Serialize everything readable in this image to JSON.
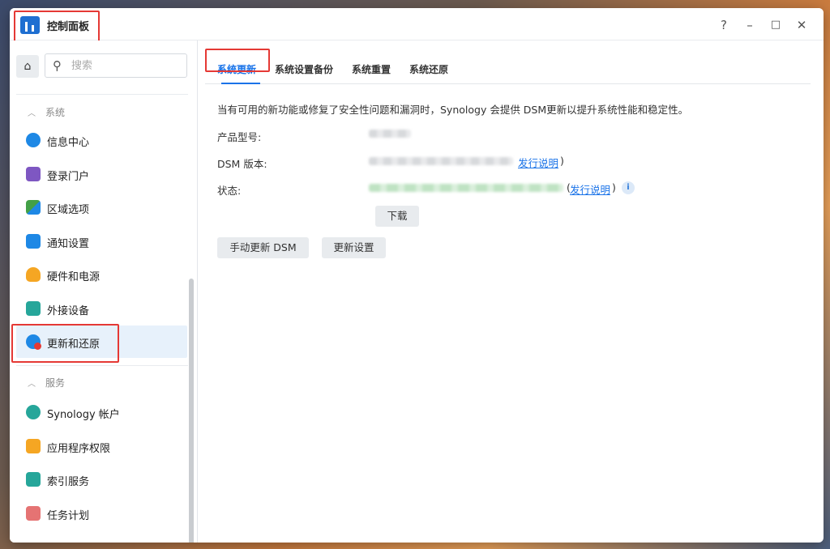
{
  "window": {
    "title": "控制面板",
    "controls": {
      "help": "?",
      "minimize": "–",
      "maximize": "□",
      "close": "✕"
    }
  },
  "sidebar": {
    "search": {
      "placeholder": "搜索"
    },
    "sections": [
      {
        "label": "系统",
        "items": [
          {
            "label": "信息中心",
            "icon": "info-icon",
            "color": "#1e88e5"
          },
          {
            "label": "登录门户",
            "icon": "login-portal-icon",
            "color": "#7e57c2"
          },
          {
            "label": "区域选项",
            "icon": "region-icon",
            "color": "#43a047"
          },
          {
            "label": "通知设置",
            "icon": "notification-icon",
            "color": "#1e88e5"
          },
          {
            "label": "硬件和电源",
            "icon": "lightbulb-icon",
            "color": "#f5a623"
          },
          {
            "label": "外接设备",
            "icon": "external-device-icon",
            "color": "#26a69a"
          },
          {
            "label": "更新和还原",
            "icon": "update-restore-icon",
            "color": "#1e88e5",
            "active": true
          }
        ]
      },
      {
        "label": "服务",
        "items": [
          {
            "label": "Synology 帐户",
            "icon": "account-icon",
            "color": "#26a69a"
          },
          {
            "label": "应用程序权限",
            "icon": "lock-icon",
            "color": "#f5a623"
          },
          {
            "label": "索引服务",
            "icon": "index-icon",
            "color": "#26a69a"
          },
          {
            "label": "任务计划",
            "icon": "calendar-icon",
            "color": "#e57373"
          }
        ]
      }
    ]
  },
  "main": {
    "tabs": [
      {
        "label": "系统更新",
        "active": true
      },
      {
        "label": "系统设置备份"
      },
      {
        "label": "系统重置"
      },
      {
        "label": "系统还原"
      }
    ],
    "description": "当有可用的新功能或修复了安全性问题和漏洞时，Synology 会提供 DSM更新以提升系统性能和稳定性。",
    "fields": {
      "model_label": "产品型号:",
      "version_label": "DSM 版本:",
      "status_label": "状态:",
      "release_notes": "发行说明",
      "paren_open": "(",
      "paren_close": ")",
      "info": "i"
    },
    "buttons": {
      "download": "下载",
      "manual_update": "手动更新 DSM",
      "update_settings": "更新设置"
    }
  },
  "colors": {
    "accent": "#1a73e8",
    "highlight": "#e53935",
    "active_bg": "#e7f1fb"
  }
}
